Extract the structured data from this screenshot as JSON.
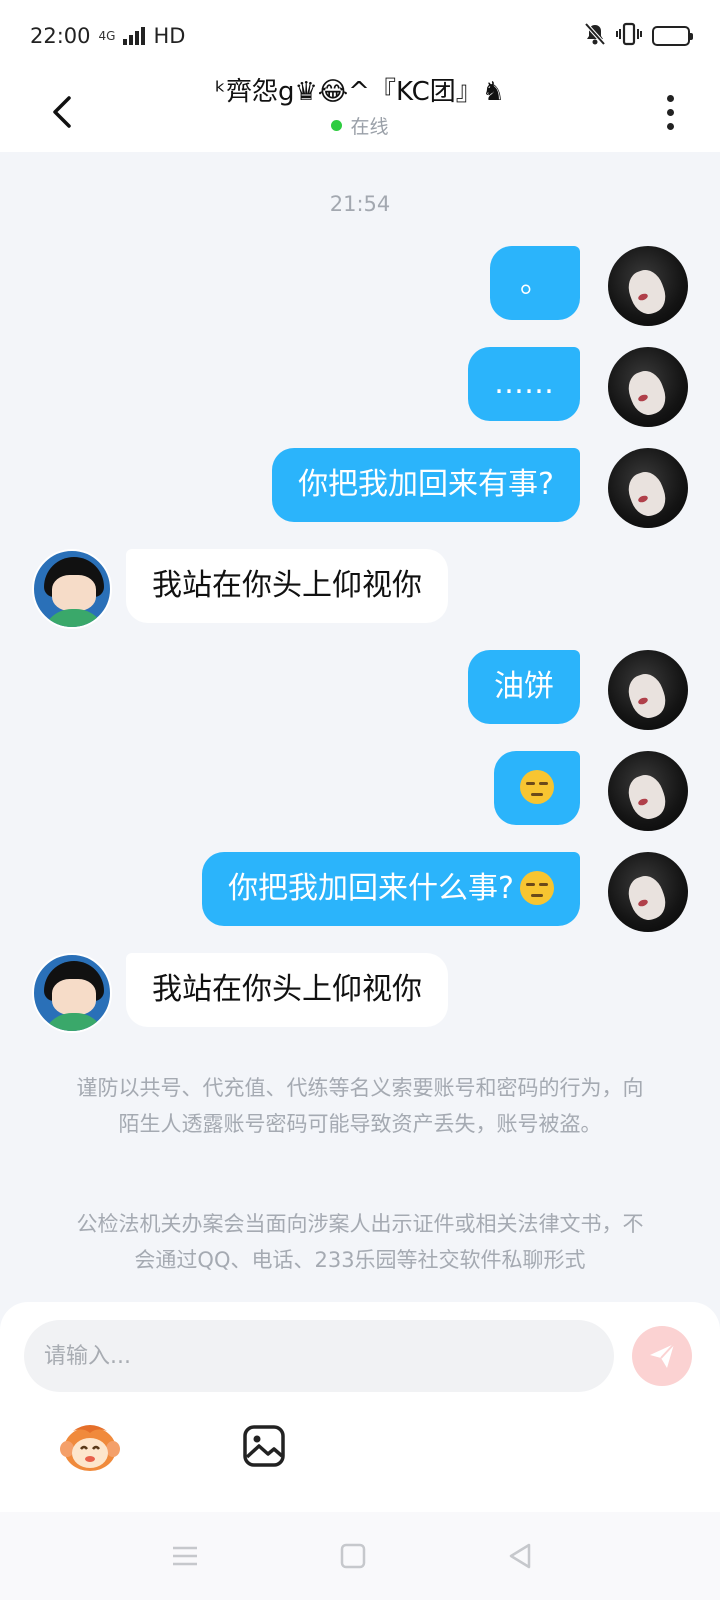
{
  "status_bar": {
    "time": "22:00",
    "network": "4G",
    "hd": "HD",
    "icons": [
      "mute-bell-icon",
      "vibrate-icon",
      "battery-icon"
    ]
  },
  "header": {
    "title": "ᵏ齊怨g♛😂^『KC团』♞",
    "status": "在线",
    "status_color": "#2ecc40"
  },
  "chat": {
    "timestamp": "21:54",
    "messages": [
      {
        "from": "me",
        "text": "。"
      },
      {
        "from": "me",
        "text": "……"
      },
      {
        "from": "me",
        "text": "你把我加回来有事?"
      },
      {
        "from": "them",
        "text": "我站在你头上仰视你"
      },
      {
        "from": "me",
        "text": "油饼"
      },
      {
        "from": "me",
        "text": "",
        "emoji": "unamused-face-emoji"
      },
      {
        "from": "me",
        "text": "你把我加回来什么事?",
        "emoji": "thinking-face-emoji"
      },
      {
        "from": "them",
        "text": "我站在你头上仰视你"
      }
    ],
    "notices": [
      "谨防以共号、代充值、代练等名义索要账号和密码的行为，向陌生人透露账号密码可能导致资产丢失，账号被盗。",
      "公检法机关办案会当面向涉案人出示证件或相关法律文书，不会通过QQ、电话、233乐园等社交软件私聊形式"
    ]
  },
  "input": {
    "placeholder": "请输入...",
    "value": ""
  },
  "colors": {
    "my_bubble": "#2bb4fb",
    "their_bubble": "#ffffff",
    "background": "#f3f5f9",
    "send_button": "#fbd2d2"
  }
}
